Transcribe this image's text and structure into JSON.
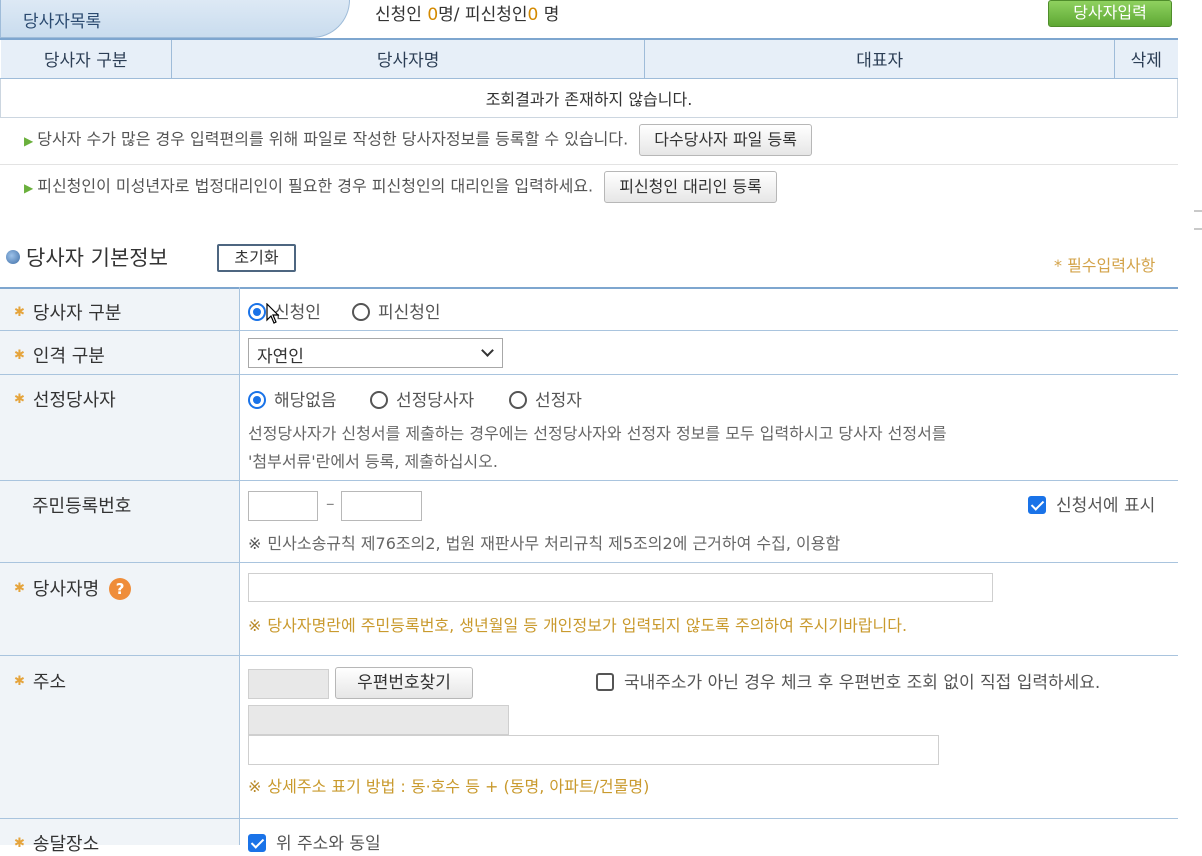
{
  "list_header": {
    "tab_label": "당사자목록",
    "count_prefix": "신청인 ",
    "applicant_count": "0",
    "count_middle": "명/ 피신청인",
    "respondent_count": "0",
    "count_suffix": " 명",
    "add_button": "당사자입력"
  },
  "list_table": {
    "columns": [
      "당사자 구분",
      "당사자명",
      "대표자",
      "삭제"
    ],
    "empty_message": "조회결과가 존재하지 않습니다."
  },
  "notices": [
    {
      "text": "당사자 수가 많은 경우 입력편의를 위해 파일로 작성한 당사자정보를 등록할 수 있습니다.",
      "button": "다수당사자 파일 등록"
    },
    {
      "text": "피신청인이 미성년자로 법정대리인이 필요한 경우 피신청인의 대리인을 입력하세요.",
      "button": "피신청인 대리인 등록"
    }
  ],
  "basic_info": {
    "title": "당사자 기본정보",
    "reset_button": "초기화",
    "required_note": "* 필수입력사항"
  },
  "form": {
    "party_type": {
      "label": "당사자 구분",
      "options": [
        "신청인",
        "피신청인"
      ],
      "selected": "신청인"
    },
    "person_type": {
      "label": "인격 구분",
      "value": "자연인"
    },
    "designated": {
      "label": "선정당사자",
      "options": [
        "해당없음",
        "선정당사자",
        "선정자"
      ],
      "selected": "해당없음",
      "desc_line1": "선정당사자가 신청서를 제출하는 경우에는 선정당사자와 선정자 정보를 모두 입력하시고 당사자 선정서를",
      "desc_line2": "'첨부서류'란에서 등록, 제출하십시오."
    },
    "resident_number": {
      "label": "주민등록번호",
      "dash": "–",
      "show_label": "신청서에 표시",
      "show_checked": true,
      "note_mark": "※",
      "note": "민사소송규칙 제76조의2, 법원 재판사무 처리규칙 제5조의2에 근거하여 수집, 이용함"
    },
    "party_name": {
      "label": "당사자명",
      "help": "?",
      "warn_mark": "※",
      "warning": "당사자명란에 주민등록번호, 생년월일 등 개인정보가 입력되지 않도록 주의하여 주시기바랍니다."
    },
    "address": {
      "label": "주소",
      "zip_button": "우편번호찾기",
      "overseas_label": "국내주소가 아닌 경우 체크 후 우편번호 조회 없이 직접 입력하세요.",
      "overseas_checked": false,
      "hint_mark": "※",
      "hint": "상세주소 표기 방법 : 동·호수 등 + (동명, 아파트/건물명)"
    },
    "delivery": {
      "label": "송달장소",
      "same_label": "위 주소와 동일",
      "same_checked": true
    }
  },
  "colors": {
    "accent_blue": "#1a73e8",
    "green_button": "#5ea834",
    "required_orange": "#e5a43c",
    "warning_text": "#c99a2e"
  }
}
